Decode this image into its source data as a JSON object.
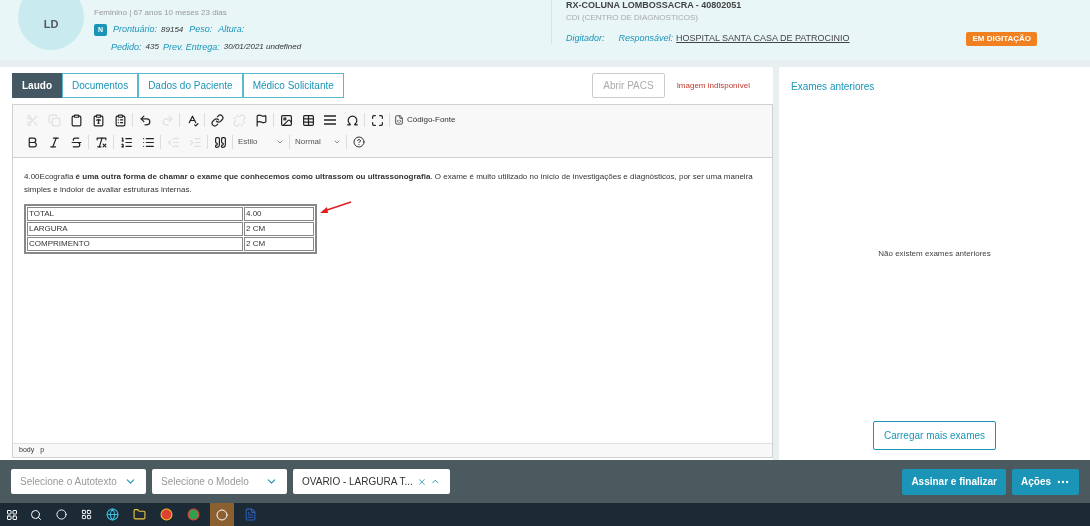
{
  "patient": {
    "initials": "LD",
    "info": "Feminino | 67 anos 10 meses 23 dias",
    "badge": "N",
    "fields": [
      {
        "label": "Prontuário:",
        "value": "89154"
      },
      {
        "label": "Peso:"
      },
      {
        "label": "Altura:"
      }
    ],
    "fields2": [
      {
        "label": "Pedido:",
        "value": "435"
      },
      {
        "label": "Prev. Entrega:",
        "value": "30/01/2021 undefined"
      }
    ]
  },
  "exam": {
    "title": "RX-COLUNA LOMBOSSACRA - 40802051",
    "unit": "CDI (CENTRO DE DIAGNOSTICOS)",
    "digitador": "Digitador:",
    "responsavel_label": "Responsável:",
    "responsavel": "HOSPITAL SANTA CASA DE PATROCINIO",
    "status": "EM DIGITAÇÃO"
  },
  "tabs": [
    {
      "label": "Laudo",
      "selected": true
    },
    {
      "label": "Documentos",
      "selected": false
    },
    {
      "label": "Dados do Paciente",
      "selected": false
    },
    {
      "label": "Médico Solicitante",
      "selected": false
    }
  ],
  "pacs_button": {
    "label": "Abrir PACS",
    "disabled": true
  },
  "image_status": "Imagem indisponível",
  "toolbar": {
    "row1": [
      {
        "disabled": true
      },
      {
        "disabled": true
      },
      {
        "disabled": false
      },
      {
        "disabled": false
      },
      {
        "disabled": false
      },
      {
        "disabled": false
      },
      {
        "disabled": true
      },
      {
        "disabled": false
      },
      {
        "disabled": false
      },
      {
        "disabled": true
      },
      {
        "disabled": false
      },
      {
        "disabled": false
      },
      {
        "disabled": false
      },
      {
        "disabled": false
      },
      {
        "disabled": false
      },
      {
        "disabled": false
      }
    ],
    "source_label": "Código-Fonte",
    "row2": [
      {
        "disabled": false
      },
      {
        "disabled": false
      },
      {
        "disabled": false
      },
      {
        "disabled": false
      },
      {
        "disabled": false
      },
      {
        "disabled": false
      },
      {
        "disabled": true
      },
      {
        "disabled": true
      },
      {
        "disabled": false
      }
    ],
    "style_select": "Estilo",
    "format_select": "Normal"
  },
  "document": {
    "paragraph": "4.00Ecografia **é uma outra forma de chamar o exame que conhecemos como ultrassom ou ultrassonografia**. O exame é muito utilizado no início de investigações e diagnósticos, por ser uma maneira simples e indolor de avaliar estruturas internas.",
    "table": [
      [
        "TOTAL",
        "4.00"
      ],
      [
        "LARGURA",
        "2 CM"
      ],
      [
        "COMPRIMENTO",
        "2 CM"
      ]
    ]
  },
  "editor_path": [
    "body",
    "p"
  ],
  "previous_exams": {
    "title": "Exames anteriores",
    "empty": "Não existem exames anteriores",
    "load_button": "Carregar mais exames"
  },
  "bottom_bar": {
    "autotext": {
      "placeholder": "Selecione o Autotexto"
    },
    "model": {
      "placeholder": "Selecione o Modelo"
    },
    "selected_model": "OVARIO - LARGURA T...",
    "sign_button": "Assinar e finalizar",
    "actions_button": "Ações"
  }
}
